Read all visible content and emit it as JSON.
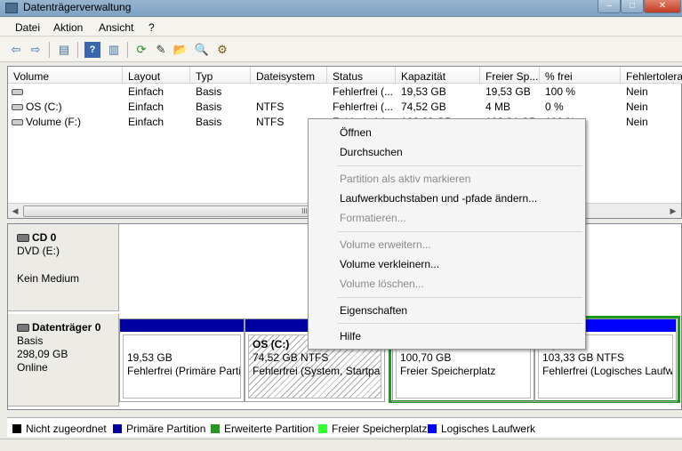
{
  "window": {
    "title": "Datenträgerverwaltung",
    "min": "–",
    "max": "□",
    "close": "✕"
  },
  "menu": [
    "Datei",
    "Aktion",
    "Ansicht",
    "?"
  ],
  "toolbar": {
    "icons": [
      "back-arrow-icon",
      "forward-arrow-icon",
      "console-tree-icon",
      "help-icon",
      "properties-pane-icon",
      "refresh-icon",
      "properties-icon",
      "open-folder-icon",
      "search-icon",
      "settings-icon"
    ],
    "glyphs": [
      "⇦",
      "⇨",
      "▤",
      "?",
      "▥",
      "⟳",
      "✎",
      "📂",
      "🔍",
      "⚙"
    ]
  },
  "volume_list": {
    "columns": [
      "Volume",
      "Layout",
      "Typ",
      "Dateisystem",
      "Status",
      "Kapazität",
      "Freier Sp...",
      "% frei",
      "Fehlertolera"
    ],
    "rows": [
      [
        "",
        "Einfach",
        "Basis",
        "",
        "Fehlerfrei (...",
        "19,53 GB",
        "19,53 GB",
        "100 %",
        "Nein"
      ],
      [
        "OS (C:)",
        "Einfach",
        "Basis",
        "NTFS",
        "Fehlerfrei (...",
        "74,52 GB",
        "4 MB",
        "0 %",
        "Nein"
      ],
      [
        "Volume (F:)",
        "Einfach",
        "Basis",
        "NTFS",
        "Fehlerfrei (...",
        "103,33 GB",
        "103,34 GB",
        "100 %",
        "Nein"
      ]
    ],
    "scroll_thumb": "III"
  },
  "disks": {
    "cd": {
      "name": "CD 0",
      "type": "DVD (E:)",
      "media": "Kein Medium"
    },
    "hdd": {
      "name": "Datenträger 0",
      "type": "Basis",
      "size": "298,09 GB",
      "state": "Online"
    }
  },
  "partitions": [
    {
      "name": "",
      "size": "19,53 GB",
      "status": "Fehlerfrei (Primäre Partit"
    },
    {
      "name": "OS  (C:)",
      "size": "74,52 GB NTFS",
      "status": "Fehlerfrei (System, Startpart"
    },
    {
      "name": "",
      "size": "100,70 GB",
      "status": "Freier Speicherplatz"
    },
    {
      "name": "F:)",
      "size": "103,33 GB NTFS",
      "status": "Fehlerfrei (Logisches Laufwe"
    }
  ],
  "legend": [
    {
      "label": "Nicht zugeordnet",
      "color": "#000000"
    },
    {
      "label": "Primäre Partition",
      "color": "#0000a0"
    },
    {
      "label": "Erweiterte Partition",
      "color": "#1f9a1f"
    },
    {
      "label": "Freier Speicherplatz",
      "color": "#33ff33"
    },
    {
      "label": "Logisches Laufwerk",
      "color": "#0000ff"
    }
  ],
  "context_menu": [
    {
      "label": "Öffnen",
      "enabled": true
    },
    {
      "label": "Durchsuchen",
      "enabled": true
    },
    {
      "label": "Partition als aktiv markieren",
      "enabled": false
    },
    {
      "label": "Laufwerkbuchstaben und -pfade ändern...",
      "enabled": true
    },
    {
      "label": "Formatieren...",
      "enabled": false
    },
    {
      "label": "Volume erweitern...",
      "enabled": false
    },
    {
      "label": "Volume verkleinern...",
      "enabled": true
    },
    {
      "label": "Volume löschen...",
      "enabled": false
    },
    {
      "label": "Eigenschaften",
      "enabled": true
    },
    {
      "label": "Hilfe",
      "enabled": true
    }
  ]
}
